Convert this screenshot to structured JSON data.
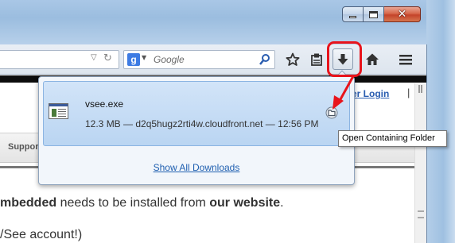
{
  "window": {
    "minimize_icon": "minimize-icon",
    "maximize_icon": "maximize-icon",
    "close_glyph": "✕"
  },
  "toolbar": {
    "search_placeholder": "Google",
    "icons": [
      "bookmark-star-icon",
      "bookmarks-menu-icon",
      "downloads-icon",
      "home-icon",
      "menu-icon"
    ]
  },
  "page": {
    "member_login": "mber Login",
    "member_pipe": "|",
    "nav_item": "Suppor",
    "body_line1_prefix": "mbedded",
    "body_line1_mid": " needs to be installed from ",
    "body_line1_link": "our website",
    "body_line1_end": ".",
    "body_line2": "/See account!)"
  },
  "downloads_panel": {
    "item": {
      "filename": "vsee.exe",
      "meta": "12.3 MB — d2q5hugz2rti4w.cloudfront.net — 12:56 PM"
    },
    "show_all": "Show All Downloads"
  },
  "tooltip": {
    "text": "Open Containing Folder"
  },
  "colors": {
    "annotation_red": "#e8141c",
    "panel_item_bg": "#c7ddf5",
    "link_blue": "#1f5fb0"
  }
}
